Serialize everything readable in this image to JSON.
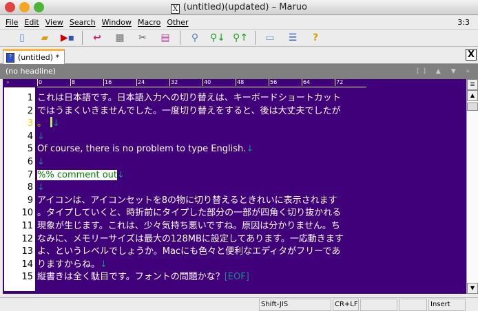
{
  "window": {
    "title": "(untitled)(updated) – Maruo",
    "x_icon": "X",
    "colors": {
      "close": "#e0443e",
      "minimize": "#f5a623",
      "zoom": "#4cb538"
    }
  },
  "menu": {
    "items": [
      "File",
      "Edit",
      "View",
      "Search",
      "Window",
      "Macro",
      "Other"
    ],
    "position": "3:3"
  },
  "toolbar": {
    "icons": [
      "new-file-icon",
      "open-folder-icon",
      "save-icon",
      "undo-icon",
      "copy-icon",
      "cut-icon",
      "paste-icon",
      "search-icon",
      "search-next-icon",
      "search-prev-icon",
      "window-icon",
      "split-icon",
      "help-icon"
    ]
  },
  "tabs": [
    {
      "label": "(untitled) *",
      "active": true
    }
  ],
  "tab_close": "X",
  "headline": {
    "text": "(no headline)"
  },
  "ruler": {
    "marks": [
      "0",
      "8",
      "16",
      "24",
      "32",
      "40",
      "48",
      "56",
      "64",
      "72"
    ],
    "prefix": "»"
  },
  "editor": {
    "colors": {
      "background": "#40007a",
      "text": "#ffffff",
      "newline": "#1e8a8a",
      "comment": "#008000"
    },
    "current_line": 3,
    "newline_mark": "↓",
    "eof_mark": "[EOF]",
    "lines": [
      {
        "n": "1",
        "text": "これは日本語です。日本語入力への切り替えは、キーボードショートカット",
        "nl": false
      },
      {
        "n": "2",
        "text": "ではうまくいきませんでした。一度切り替えをすると、後は大丈夫でしたが",
        "nl": false
      },
      {
        "n": "3",
        "text": "。",
        "nl": true
      },
      {
        "n": "4",
        "text": "",
        "nl": true
      },
      {
        "n": "5",
        "text": "Of course, there is no problem to type English.",
        "nl": true
      },
      {
        "n": "6",
        "text": "",
        "nl": true
      },
      {
        "n": "7",
        "text": "%% comment out",
        "nl": true,
        "comment": true
      },
      {
        "n": "8",
        "text": "",
        "nl": true
      },
      {
        "n": "9",
        "text": "アイコンは、アイコンセットを8の物に切り替えるときれいに表示されます",
        "nl": false
      },
      {
        "n": "10",
        "text": "。タイプしていくと、時折前にタイプした部分の一部が四角く切り抜かれる",
        "nl": false
      },
      {
        "n": "11",
        "text": "現象が生じます。これは、少々気持ち悪いですね。原因は分かりません。ち",
        "nl": false
      },
      {
        "n": "12",
        "text": "なみに、メモリーサイズは最大の128MBに設定してあります。一応動きます",
        "nl": false
      },
      {
        "n": "13",
        "text": "よ、というレベルでしょうか。Macにも色々と便利なエディタがフリーであ",
        "nl": false
      },
      {
        "n": "14",
        "text": "りますからね。",
        "nl": true
      },
      {
        "n": "15",
        "text": "縦書きは全く駄目です。フォントの問題かな？",
        "nl": false,
        "eof": true
      }
    ]
  },
  "status": {
    "encoding": "Shift-JIS",
    "line_ending": "CR+LF",
    "mode": "Insert"
  }
}
